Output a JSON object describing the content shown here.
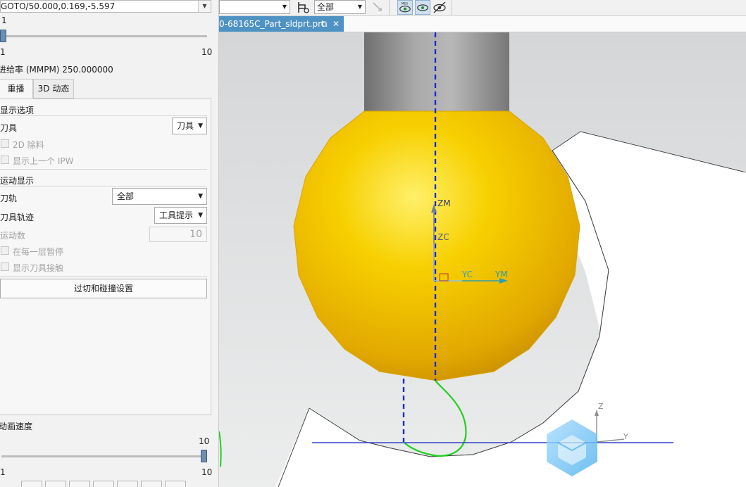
{
  "panel": {
    "goto_text": "GOTO/50.000,0.169,-5.597",
    "step_current": "1",
    "step_min": "1",
    "step_max": "10",
    "feedrate_label": "进给率 (MMPM) 250.000000",
    "tabs": [
      {
        "label": "重播"
      },
      {
        "label": "3D 动态"
      }
    ],
    "display_options_title": "显示选项",
    "tool_label": "刀具",
    "tool_value": "刀具",
    "remove_2d_label": "2D 除料",
    "show_prev_ipw_label": "显示上一个 IPW",
    "motion_display_title": "运动显示",
    "toolpath_label": "刀轨",
    "toolpath_value": "全部",
    "tool_trace_label": "刀具轨迹",
    "tool_trace_value": "工具提示",
    "motion_count_label": "运动数",
    "motion_count_value": "10",
    "pause_each_layer_label": "在每一层暂停",
    "show_tool_contact_label": "显示刀具接触",
    "gouge_button_label": "过切和碰撞设置",
    "anim_speed_label": "动画速度",
    "speed_current": "10",
    "speed_min": "1",
    "speed_max": "10"
  },
  "toolbar": {
    "select1_value": "",
    "select2_value": "全部"
  },
  "file_tab": {
    "title": "0-68165C_Part_sldprt.prt"
  },
  "viewport": {
    "axes": {
      "zm": "ZM",
      "zc": "ZC",
      "yc": "YC",
      "ym": "YM",
      "z": "Z",
      "y": "Y"
    },
    "colors": {
      "ball": "#f2c400",
      "shank": "#8a8a8a",
      "path": "#1fd01f",
      "dashed": "#1a2bd6"
    }
  }
}
